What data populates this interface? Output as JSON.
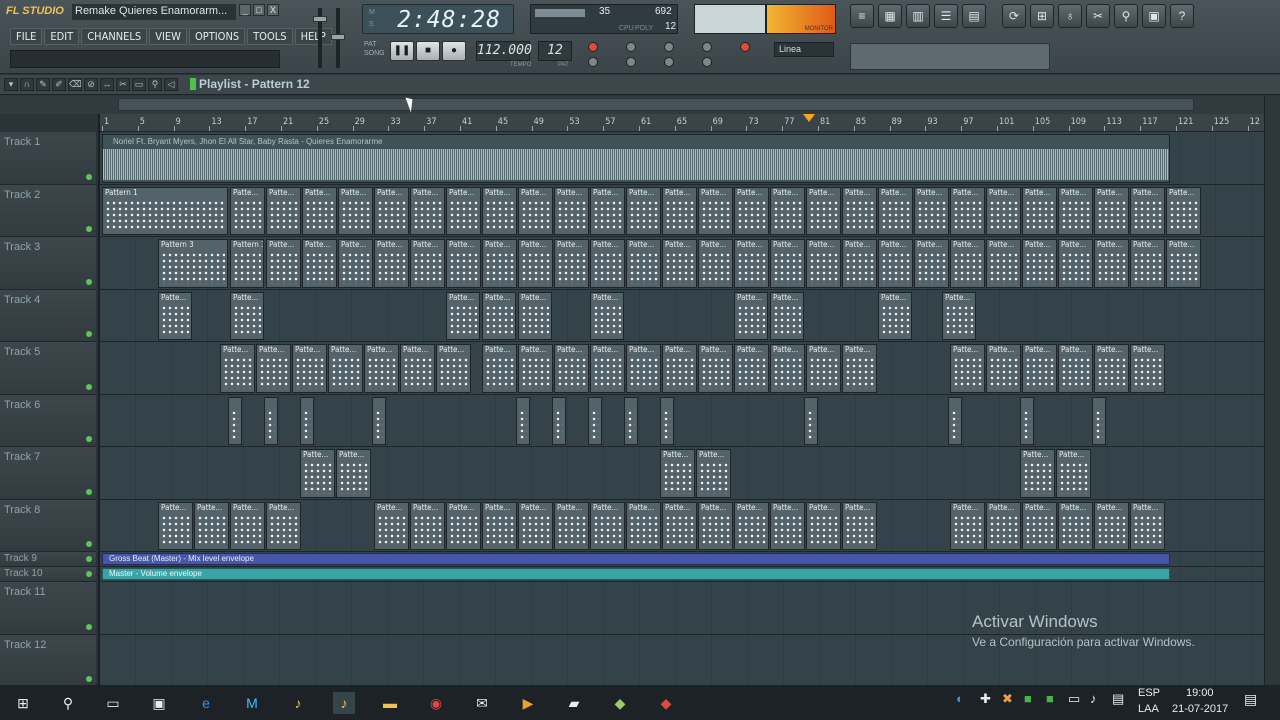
{
  "app": {
    "logo": "FL STUDIO",
    "project_title": "Remake Quieres Enamorarm...",
    "window_buttons": [
      "_",
      "□",
      "X"
    ]
  },
  "menu": [
    "FILE",
    "EDIT",
    "CHANNELS",
    "VIEW",
    "OPTIONS",
    "TOOLS",
    "HELP"
  ],
  "time_display": {
    "label_top": "M",
    "label_bottom": "S",
    "time": "2:48:28"
  },
  "transport": {
    "pat_label": "PAT",
    "song_label": "SONG",
    "tempo": "112.000",
    "tempo_label": "TEMPO",
    "pattern": "12",
    "pattern_label": "PAT"
  },
  "cpu": {
    "poly_val": "35",
    "ram_val": "692",
    "cpu_label": "CPU",
    "poly_label": "POLY",
    "poly2": "12"
  },
  "meter": {
    "label": "MONITOR"
  },
  "snap": {
    "value": "Linea"
  },
  "toolbar_icons": [
    "≡",
    "▦",
    "▥",
    "☰",
    "▤",
    "⟳",
    "⊞",
    "♁",
    "✂",
    "⚲",
    "▣",
    "?"
  ],
  "playlist": {
    "title": "Playlist - Pattern 12"
  },
  "ruler": {
    "ticks": [
      "1",
      "5",
      "9",
      "13",
      "17",
      "21",
      "25",
      "29",
      "33",
      "37",
      "41",
      "45",
      "49",
      "53",
      "57",
      "61",
      "65",
      "69",
      "73",
      "77",
      "81",
      "85",
      "89",
      "93",
      "97",
      "101",
      "105",
      "109",
      "113",
      "117",
      "121",
      "125",
      "12"
    ]
  },
  "tracks": [
    {
      "name": "Track 1"
    },
    {
      "name": "Track 2"
    },
    {
      "name": "Track 3"
    },
    {
      "name": "Track 4"
    },
    {
      "name": "Track 5"
    },
    {
      "name": "Track 6"
    },
    {
      "name": "Track 7"
    },
    {
      "name": "Track 8"
    },
    {
      "name": "Track 9"
    },
    {
      "name": "Track 10"
    },
    {
      "name": "Track 11"
    },
    {
      "name": "Track 12"
    }
  ],
  "clips": {
    "audio": "Noriel Ft. Bryant Myers, Jhon El All Star, Baby Rasta - Quieres Enamorarme",
    "pattern1": "Pattern 1",
    "pattern3": "Pattern 3",
    "patte": "Patte...",
    "env1": "Gross Beat (Master) - Mix level envelope",
    "env2": "Master - Volume envelope"
  },
  "watermark": {
    "line1": "Activar Windows",
    "line2": "Ve a Configuración para activar Windows."
  },
  "taskbar": {
    "lang1": "ESP",
    "lang2": "LAA",
    "time": "19:00",
    "date": "21-07-2017"
  }
}
